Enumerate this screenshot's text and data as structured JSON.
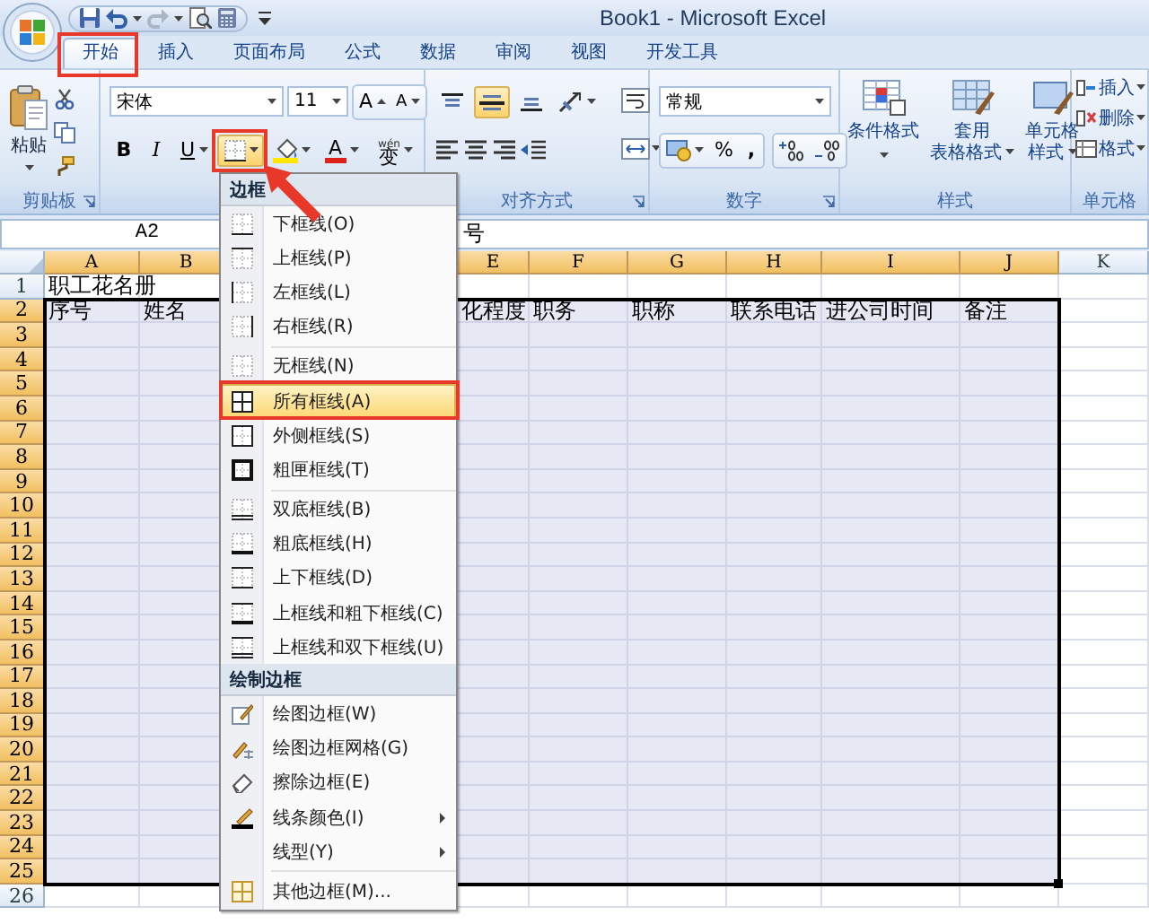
{
  "window": {
    "title": "Book1 - Microsoft Excel"
  },
  "tabs": [
    {
      "label": "开始",
      "selected": true
    },
    {
      "label": "插入",
      "selected": false
    },
    {
      "label": "页面布局",
      "selected": false
    },
    {
      "label": "公式",
      "selected": false
    },
    {
      "label": "数据",
      "selected": false
    },
    {
      "label": "审阅",
      "selected": false
    },
    {
      "label": "视图",
      "selected": false
    },
    {
      "label": "开发工具",
      "selected": false
    }
  ],
  "clipboard": {
    "paste": "粘贴",
    "group_label": "剪贴板"
  },
  "font": {
    "name": "宋体",
    "size": "11",
    "grow": "A",
    "shrink": "A",
    "bold": "B",
    "italic": "I",
    "underline": "U",
    "font_color": "A",
    "phonetic_ruby": "wén",
    "phonetic_char": "变"
  },
  "alignment": {
    "vertical": [
      {
        "selected": false
      },
      {
        "selected": true
      },
      {
        "selected": false
      }
    ],
    "group_label": "对齐方式"
  },
  "number": {
    "format": "常规",
    "percent": "%",
    "comma": ",",
    "group_label": "数字"
  },
  "styles": {
    "buttons": [
      {
        "lines": [
          "条件格式"
        ]
      },
      {
        "lines": [
          "套用",
          "表格格式"
        ]
      },
      {
        "lines": [
          "单元格",
          "样式"
        ]
      }
    ],
    "group_label": "样式"
  },
  "cells": {
    "buttons": [
      "插入",
      "删除",
      "格式"
    ],
    "group_label": "单元格"
  },
  "formula_bar": {
    "name_box": "A2",
    "content": "号"
  },
  "sheet": {
    "columns": [
      {
        "label": "A",
        "selected": true
      },
      {
        "label": "B",
        "selected": true
      },
      {
        "label": "E",
        "selected": true
      },
      {
        "label": "F",
        "selected": true
      },
      {
        "label": "G",
        "selected": true
      },
      {
        "label": "H",
        "selected": true
      },
      {
        "label": "I",
        "selected": true
      },
      {
        "label": "J",
        "selected": true
      },
      {
        "label": "K",
        "selected": false
      }
    ],
    "rows": [
      {
        "label": "1",
        "selected": false,
        "cells": [
          "职工花名册"
        ]
      },
      {
        "label": "2",
        "selected": true,
        "cells": [
          "序号",
          "姓名",
          "化程度",
          "职务",
          "职称",
          "联系电话",
          "进公司时间",
          "备注"
        ]
      },
      {
        "label": "3",
        "selected": true
      },
      {
        "label": "4",
        "selected": true
      },
      {
        "label": "5",
        "selected": true
      },
      {
        "label": "6",
        "selected": true
      },
      {
        "label": "7",
        "selected": true
      },
      {
        "label": "8",
        "selected": true
      },
      {
        "label": "9",
        "selected": true
      },
      {
        "label": "10",
        "selected": true
      },
      {
        "label": "11",
        "selected": true
      },
      {
        "label": "12",
        "selected": true
      },
      {
        "label": "13",
        "selected": true
      },
      {
        "label": "14",
        "selected": true
      },
      {
        "label": "15",
        "selected": true
      },
      {
        "label": "16",
        "selected": true
      },
      {
        "label": "17",
        "selected": true
      },
      {
        "label": "18",
        "selected": true
      },
      {
        "label": "19",
        "selected": true
      },
      {
        "label": "20",
        "selected": true
      },
      {
        "label": "21",
        "selected": true
      },
      {
        "label": "22",
        "selected": true
      },
      {
        "label": "23",
        "selected": true
      },
      {
        "label": "24",
        "selected": true
      },
      {
        "label": "25",
        "selected": true
      },
      {
        "label": "26",
        "selected": false
      }
    ]
  },
  "border_menu": {
    "sections": [
      {
        "title": "边框",
        "groups": [
          [
            {
              "label": "下框线(O)",
              "selected": false,
              "submenu": false
            },
            {
              "label": "上框线(P)",
              "selected": false,
              "submenu": false
            },
            {
              "label": "左框线(L)",
              "selected": false,
              "submenu": false
            },
            {
              "label": "右框线(R)",
              "selected": false,
              "submenu": false
            }
          ],
          [
            {
              "label": "无框线(N)",
              "selected": false,
              "submenu": false
            },
            {
              "label": "所有框线(A)",
              "selected": true,
              "submenu": false
            },
            {
              "label": "外侧框线(S)",
              "selected": false,
              "submenu": false
            },
            {
              "label": "粗匣框线(T)",
              "selected": false,
              "submenu": false
            }
          ],
          [
            {
              "label": "双底框线(B)",
              "selected": false,
              "submenu": false
            },
            {
              "label": "粗底框线(H)",
              "selected": false,
              "submenu": false
            },
            {
              "label": "上下框线(D)",
              "selected": false,
              "submenu": false
            },
            {
              "label": "上框线和粗下框线(C)",
              "selected": false,
              "submenu": false
            },
            {
              "label": "上框线和双下框线(U)",
              "selected": false,
              "submenu": false
            }
          ]
        ]
      },
      {
        "title": "绘制边框",
        "groups": [
          [
            {
              "label": "绘图边框(W)",
              "selected": false,
              "submenu": false
            },
            {
              "label": "绘图边框网格(G)",
              "selected": false,
              "submenu": false
            },
            {
              "label": "擦除边框(E)",
              "selected": false,
              "submenu": false
            },
            {
              "label": "线条颜色(I)",
              "selected": false,
              "submenu": true
            },
            {
              "label": "线型(Y)",
              "selected": false,
              "submenu": true
            }
          ],
          [
            {
              "label": "其他边框(M)...",
              "selected": false,
              "submenu": false
            }
          ]
        ]
      }
    ]
  }
}
